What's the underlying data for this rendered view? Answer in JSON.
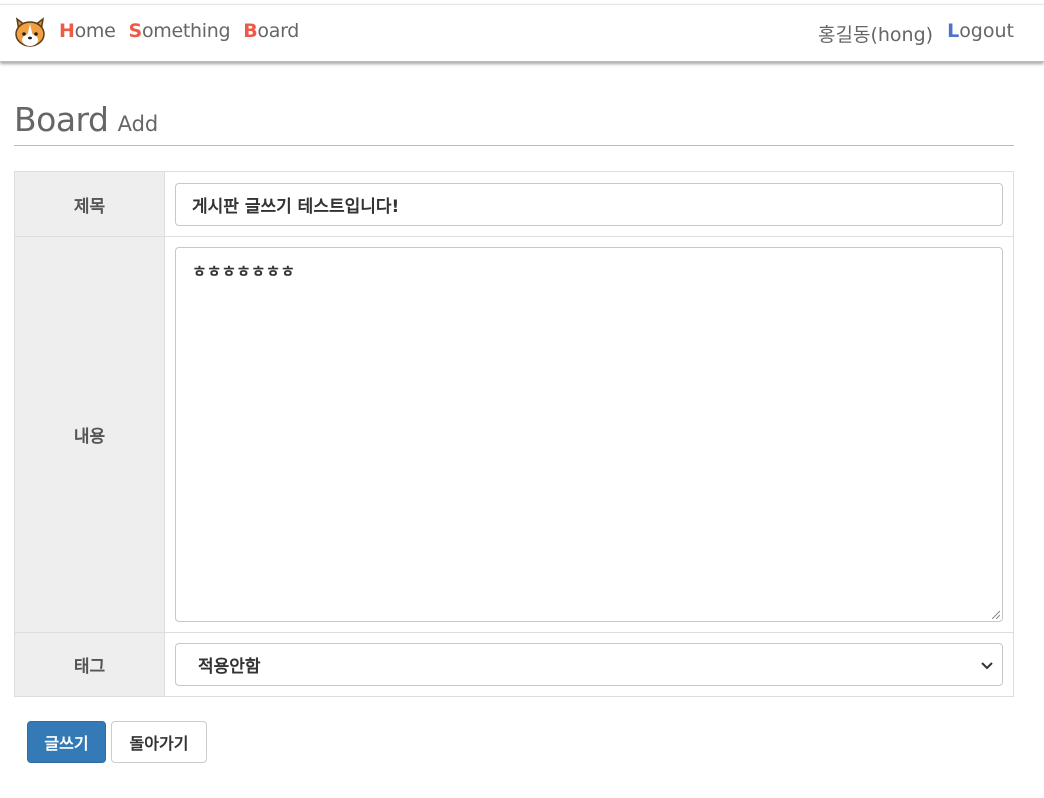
{
  "nav": {
    "links": [
      {
        "first": "H",
        "rest": "ome"
      },
      {
        "first": "S",
        "rest": "omething"
      },
      {
        "first": "B",
        "rest": "oard"
      }
    ],
    "user": "홍길동(hong)",
    "logout": {
      "first": "L",
      "rest": "ogout"
    }
  },
  "page": {
    "title": "Board",
    "subtitle": "Add"
  },
  "form": {
    "title_label": "제목",
    "title_value": "게시판 글쓰기 테스트입니다!",
    "content_label": "내용",
    "content_value": "ㅎㅎㅎㅎㅎㅎㅎ",
    "tag_label": "태그",
    "tag_selected": "적용안함"
  },
  "buttons": {
    "write": "글쓰기",
    "back": "돌아가기"
  },
  "colors": {
    "accent_red": "#ef5a47",
    "accent_blue": "#4f73c9",
    "primary": "#337ab7"
  },
  "icons": {
    "logo": "corgi-face-icon",
    "select": "chevron-down-icon",
    "resize": "resize-handle-icon"
  }
}
